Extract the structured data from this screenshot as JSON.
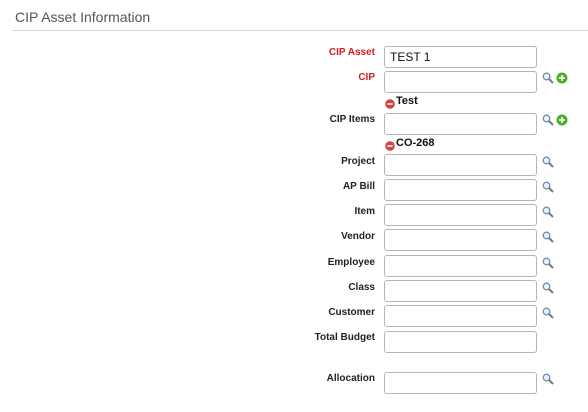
{
  "section": {
    "title": "CIP Asset Information"
  },
  "fields": {
    "cip_asset": {
      "label": "CIP Asset",
      "value": "TEST 1"
    },
    "cip": {
      "label": "CIP",
      "value": "",
      "tag": "Test"
    },
    "cip_items": {
      "label": "CIP Items",
      "value": "",
      "tag": "CO-268"
    },
    "project": {
      "label": "Project",
      "value": ""
    },
    "ap_bill": {
      "label": "AP Bill",
      "value": ""
    },
    "item": {
      "label": "Item",
      "value": ""
    },
    "vendor": {
      "label": "Vendor",
      "value": ""
    },
    "employee": {
      "label": "Employee",
      "value": ""
    },
    "class": {
      "label": "Class",
      "value": ""
    },
    "customer": {
      "label": "Customer",
      "value": ""
    },
    "total_budget": {
      "label": "Total Budget",
      "value": ""
    },
    "allocation": {
      "label": "Allocation",
      "value": ""
    }
  },
  "colors": {
    "required_label": "#d81e1e",
    "add_icon": "#4caf2a",
    "remove_icon": "#d94040"
  },
  "icons": {
    "search": "magnifier-icon",
    "add": "green-plus-icon",
    "remove": "red-minus-icon"
  }
}
